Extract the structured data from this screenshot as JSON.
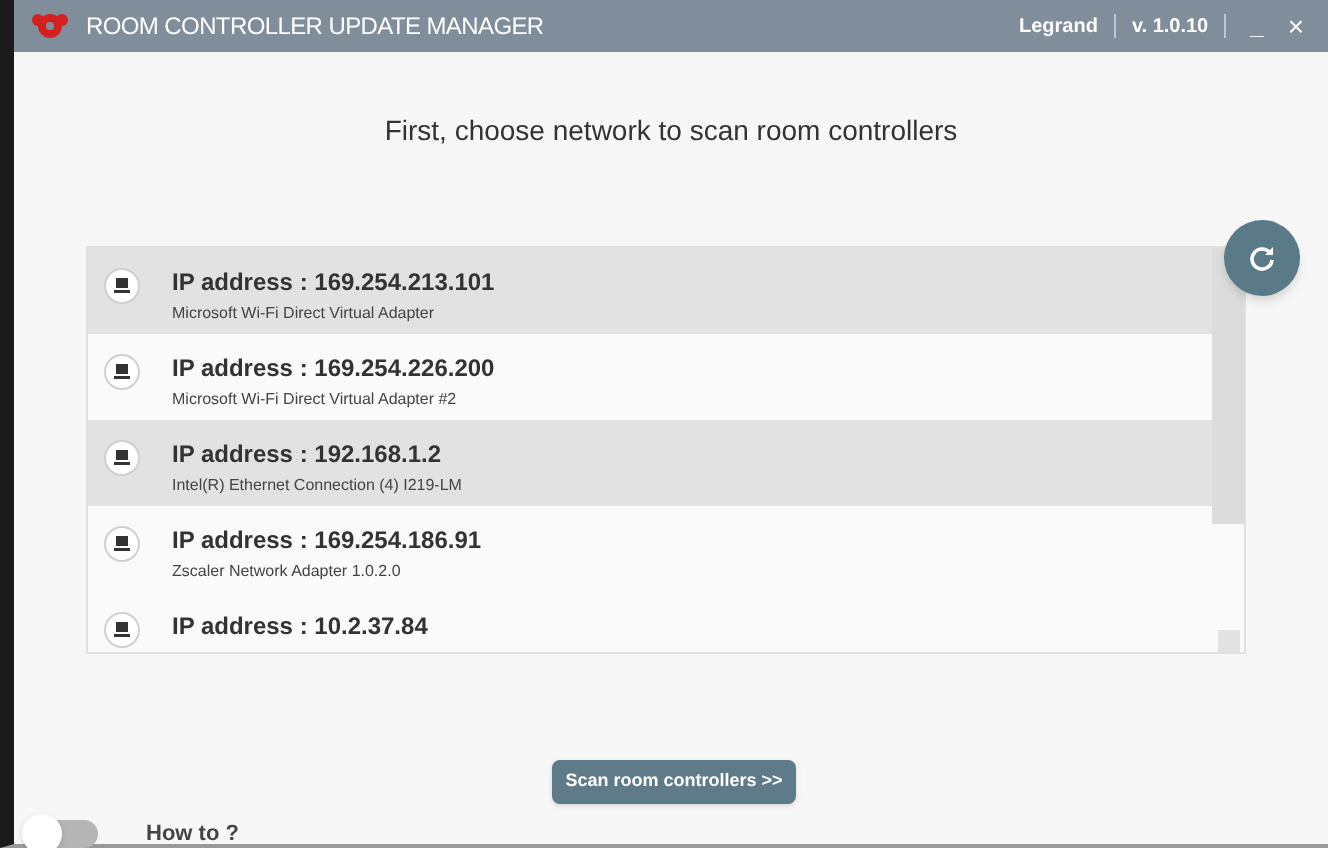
{
  "window": {
    "title": "ROOM CONTROLLER UPDATE MANAGER",
    "brand": "Legrand",
    "version": "v. 1.0.10",
    "minimize": "_",
    "close": "×"
  },
  "heading": "First, choose network to scan room controllers",
  "networks": [
    {
      "ip": "IP address : 169.254.213.101",
      "adapter": "Microsoft Wi-Fi Direct Virtual Adapter",
      "selected": true
    },
    {
      "ip": "IP address : 169.254.226.200",
      "adapter": "Microsoft Wi-Fi Direct Virtual Adapter #2",
      "selected": false
    },
    {
      "ip": "IP address : 192.168.1.2",
      "adapter": "Intel(R) Ethernet Connection (4) I219-LM",
      "selected": true
    },
    {
      "ip": "IP address : 169.254.186.91",
      "adapter": "Zscaler Network Adapter 1.0.2.0",
      "selected": false
    },
    {
      "ip": "IP address : 10.2.37.84",
      "selected": false
    }
  ],
  "scan_button": "Scan room controllers >>",
  "how_to": {
    "label": "How to ?",
    "on": false
  }
}
